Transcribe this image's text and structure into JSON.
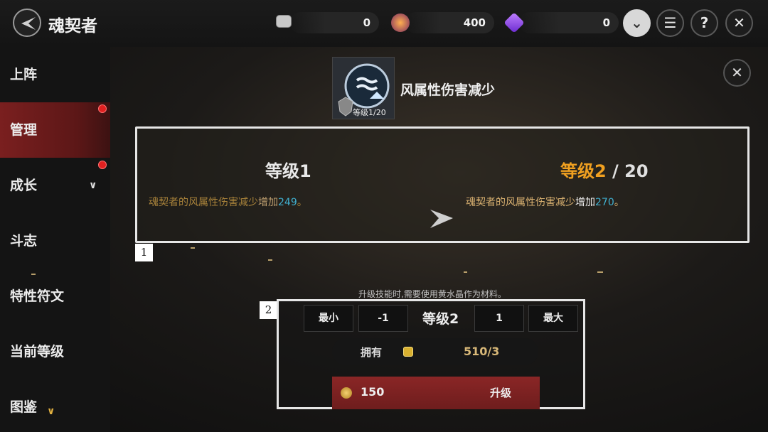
{
  "header": {
    "title": "魂契者",
    "currencies": [
      {
        "icon": "ticket-icon",
        "value": "0"
      },
      {
        "icon": "medal-icon",
        "value": "400"
      },
      {
        "icon": "purple-crystal-icon",
        "value": "0"
      }
    ]
  },
  "sidebar": {
    "items": [
      {
        "label": "上阵"
      },
      {
        "label": "管理"
      },
      {
        "label": "成长"
      },
      {
        "label": "斗志"
      },
      {
        "label": "特性符文"
      },
      {
        "label": "当前等级"
      },
      {
        "label": "图鉴"
      }
    ]
  },
  "skill": {
    "name": "风属性伤害减少",
    "level_badge": "等级1/20"
  },
  "compare": {
    "current_level": "等级1",
    "next_level_prefix": "等级2",
    "next_level_suffix": " / 20",
    "current_desc_prefix": "魂契者的风属性伤害减少",
    "current_desc_mid": "增加",
    "current_value": "249",
    "current_desc_end": "。",
    "next_desc_prefix": "魂契者的风属性伤害减少",
    "next_desc_mid": "增加",
    "next_value": "270",
    "next_desc_end": "。",
    "marker": "1"
  },
  "upgrade": {
    "hint": "升级技能时,需要使用黄水晶作为材料。",
    "marker": "2",
    "min_label": "最小",
    "minus_label": "-1",
    "level_label": "等级2",
    "qty_value": "1",
    "max_label": "最大",
    "own_label": "拥有",
    "own_value": "510/3",
    "cost": "150",
    "upgrade_label": "升级"
  },
  "colors": {
    "accent_orange": "#f0a020",
    "accent_blue": "#40b0d0",
    "sidebar_active": "#7a1f1f",
    "upgrade_button": "#8a2626"
  }
}
